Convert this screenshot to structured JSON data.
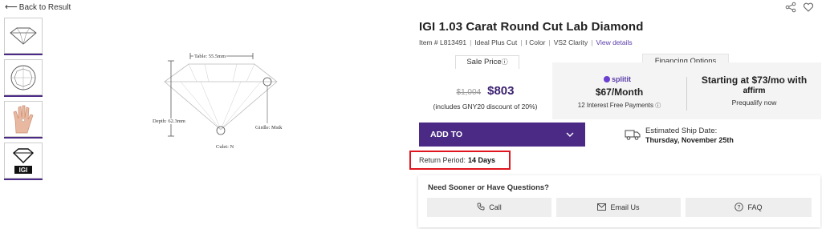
{
  "nav": {
    "back_label": "Back to Result"
  },
  "icons": {
    "share": "share-icon",
    "favorite": "heart-icon"
  },
  "thumbnails": [
    {
      "name": "diamond-profile-thumb"
    },
    {
      "name": "diamond-top-view-thumb"
    },
    {
      "name": "hand-size-thumb"
    },
    {
      "name": "igi-certificate-thumb"
    }
  ],
  "diagram": {
    "table": "Table: 55.5mm",
    "depth": "Depth: 62.3mm",
    "girdle": "Girdle: Mstk",
    "culet": "Culet: N"
  },
  "product": {
    "title": "IGI 1.03 Carat Round Cut Lab Diamond",
    "item": "Item # L813491",
    "cut": "Ideal Plus Cut",
    "color": "I Color",
    "clarity": "VS2 Clarity",
    "details_link": "View details"
  },
  "pricing": {
    "tab_label": "Sale Price",
    "old_price": "$1,004",
    "new_price": "$803",
    "discount_note": "(includes GNY20 discount of 20%)"
  },
  "financing": {
    "tab_label": "Financing Options",
    "split_logo": "splitit",
    "split_amount": "$67/Month",
    "split_note": "12 Interest Free Payments",
    "affirm_line": "Starting at $73/mo with",
    "affirm_logo": "affirm",
    "prequalify": "Prequalify now"
  },
  "cart": {
    "add_label": "ADD TO"
  },
  "shipping": {
    "label": "Estimated Ship Date:",
    "date": "Thursday, November 25th"
  },
  "returns": {
    "label": "Return Period:",
    "value": "14 Days"
  },
  "help": {
    "title": "Need Sooner or Have Questions?",
    "call": "Call",
    "email": "Email Us",
    "faq": "FAQ"
  },
  "colors": {
    "brand": "#4b2a85",
    "highlight": "#e0141e",
    "panel": "#f4f4f4"
  }
}
